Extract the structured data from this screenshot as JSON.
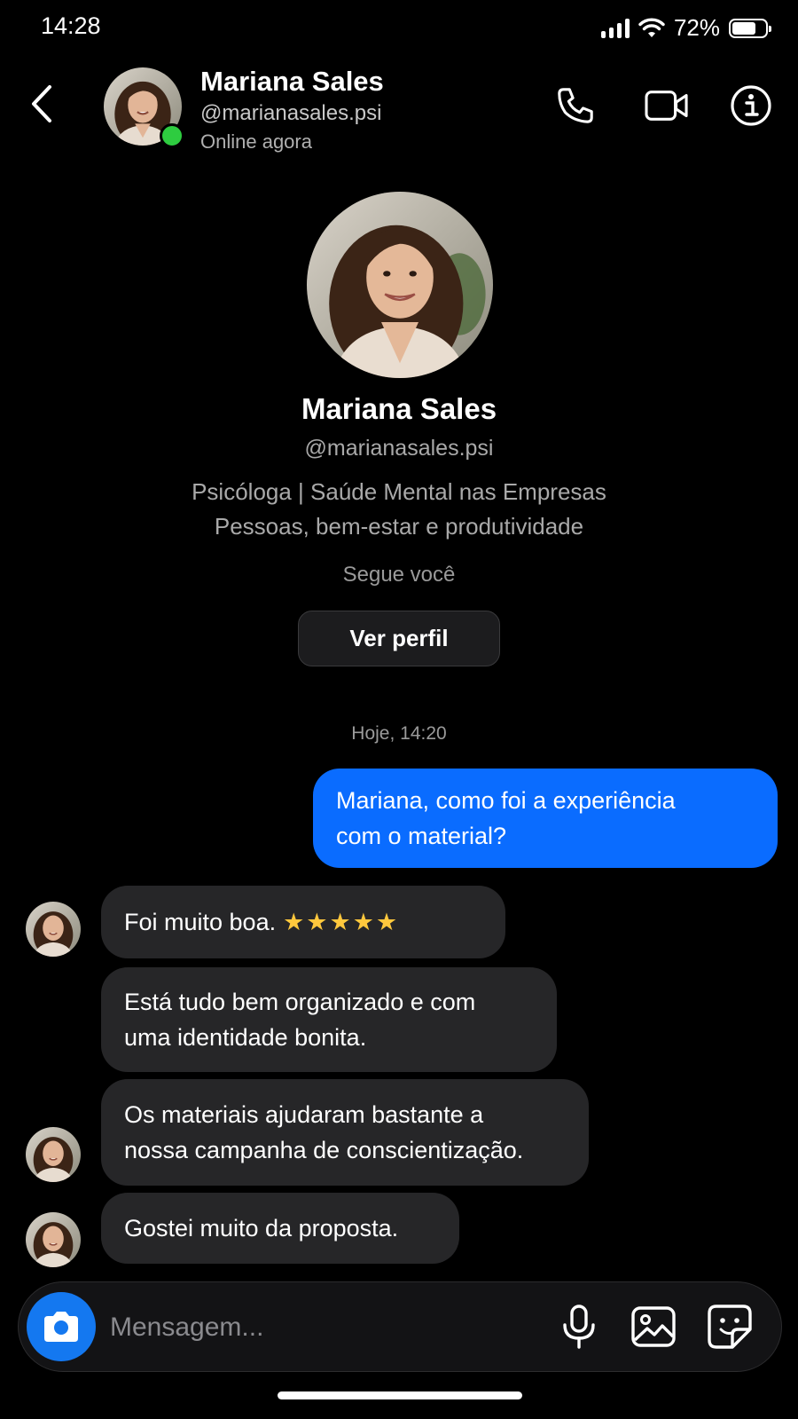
{
  "status_bar": {
    "time": "14:28",
    "battery": "72%",
    "battery_level": 0.72
  },
  "header": {
    "name": "Mariana Sales",
    "handle": "@marianasales.psi",
    "status": "Online agora",
    "icons": [
      "back-icon",
      "phone-icon",
      "video-icon",
      "info-icon"
    ]
  },
  "profile": {
    "name": "Mariana Sales",
    "handle": "@marianasales.psi",
    "bio_line1": "Psicóloga | Saúde Mental nas Empresas",
    "bio_line2": "Pessoas, bem-estar e produtividade",
    "follow_status": "Segue você",
    "view_profile_label": "Ver perfil"
  },
  "chat": {
    "date_separator": "Hoje, 14:20",
    "messages": [
      {
        "direction": "outgoing",
        "line1": "Mariana, como foi a experiência",
        "line2": "com o material?"
      },
      {
        "direction": "incoming",
        "text": "Foi muito boa.",
        "stars": "★★★★★",
        "rating": 5
      },
      {
        "direction": "incoming",
        "line1": "Está tudo bem organizado e com",
        "line2": "uma identidade bonita."
      },
      {
        "direction": "incoming",
        "line1": "Os materiais ajudaram bastante a",
        "line2": "nossa campanha de conscientização."
      },
      {
        "direction": "incoming",
        "text": "Gostei muito da proposta."
      }
    ]
  },
  "composer": {
    "placeholder": "Mensagem...",
    "icons": [
      "camera-icon",
      "microphone-icon",
      "gallery-icon",
      "sticker-icon"
    ]
  },
  "colors": {
    "accent": "#0a6cff",
    "incoming_bubble": "#262628",
    "online": "#2ecc40",
    "camera_button": "#1478f0"
  }
}
